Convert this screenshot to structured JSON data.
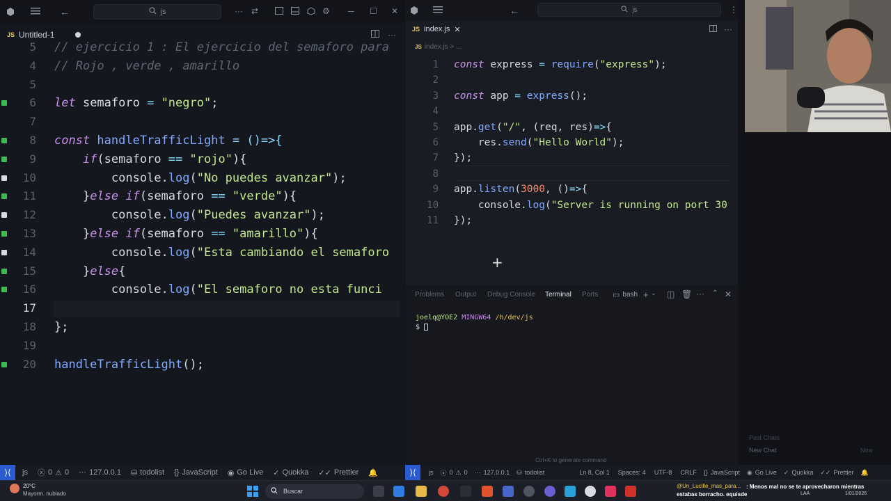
{
  "left_window": {
    "search_text": "js",
    "tab": {
      "badge": "JS",
      "label": "Untitled-1"
    },
    "lines": [
      {
        "num": "5",
        "tokens": [
          [
            "c",
            "// ejercicio 1 : El ejercicio del semaforo para"
          ]
        ]
      },
      {
        "num": "4",
        "tokens": [
          [
            "c",
            "// Rojo , verde , amarillo"
          ]
        ]
      },
      {
        "num": "5",
        "tokens": []
      },
      {
        "num": "6",
        "tokens": [
          [
            "k",
            "let"
          ],
          [
            "v",
            " semaforo "
          ],
          [
            "p",
            "="
          ],
          [
            "s",
            " \"negro\""
          ],
          [
            "v",
            ";"
          ]
        ]
      },
      {
        "num": "7",
        "tokens": []
      },
      {
        "num": "8",
        "tokens": [
          [
            "k",
            "const"
          ],
          [
            "f",
            " handleTrafficLight"
          ],
          [
            "p",
            " = ()=>{"
          ]
        ]
      },
      {
        "num": "9",
        "tokens": [
          [
            "v",
            "    "
          ],
          [
            "k",
            "if"
          ],
          [
            "v",
            "(semaforo "
          ],
          [
            "p",
            "=="
          ],
          [
            "s",
            " \"rojo\""
          ],
          [
            "v",
            "){"
          ]
        ]
      },
      {
        "num": "10",
        "tokens": [
          [
            "v",
            "        console."
          ],
          [
            "f",
            "log"
          ],
          [
            "v",
            "("
          ],
          [
            "s",
            "\"No puedes avanzar\""
          ],
          [
            "v",
            ");"
          ]
        ]
      },
      {
        "num": "11",
        "tokens": [
          [
            "v",
            "    }"
          ],
          [
            "k",
            "else if"
          ],
          [
            "v",
            "(semaforo "
          ],
          [
            "p",
            "=="
          ],
          [
            "s",
            " \"verde\""
          ],
          [
            "v",
            "){"
          ]
        ]
      },
      {
        "num": "12",
        "tokens": [
          [
            "v",
            "        console."
          ],
          [
            "f",
            "log"
          ],
          [
            "v",
            "("
          ],
          [
            "s",
            "\"Puedes avanzar\""
          ],
          [
            "v",
            ");"
          ]
        ]
      },
      {
        "num": "13",
        "tokens": [
          [
            "v",
            "    }"
          ],
          [
            "k",
            "else if"
          ],
          [
            "v",
            "(semaforo "
          ],
          [
            "p",
            "=="
          ],
          [
            "s",
            " \"amarillo\""
          ],
          [
            "v",
            "){"
          ]
        ]
      },
      {
        "num": "14",
        "tokens": [
          [
            "v",
            "        console."
          ],
          [
            "f",
            "log"
          ],
          [
            "v",
            "("
          ],
          [
            "s",
            "\"Esta cambiando el semaforo"
          ]
        ]
      },
      {
        "num": "15",
        "tokens": [
          [
            "v",
            "    }"
          ],
          [
            "k",
            "else"
          ],
          [
            "v",
            "{"
          ]
        ]
      },
      {
        "num": "16",
        "tokens": [
          [
            "v",
            "        console."
          ],
          [
            "f",
            "log"
          ],
          [
            "v",
            "("
          ],
          [
            "s",
            "\"El semaforo no esta funci"
          ]
        ]
      },
      {
        "num": "17",
        "tokens": [
          [
            "v",
            "    }"
          ]
        ]
      },
      {
        "num": "18",
        "tokens": [
          [
            "v",
            "};"
          ]
        ]
      },
      {
        "num": "19",
        "tokens": []
      },
      {
        "num": "20",
        "tokens": [
          [
            "f",
            "handleTrafficLight"
          ],
          [
            "v",
            "();"
          ]
        ]
      }
    ],
    "status": {
      "lang_short": "js",
      "errors": "0",
      "warnings": "0",
      "host": "127.0.0.1",
      "branch": "todolist",
      "language": "JavaScript",
      "go_live": "Go Live",
      "quokka": "Quokka",
      "prettier": "Prettier"
    }
  },
  "right_window": {
    "search_text": "js",
    "tab": {
      "badge": "JS",
      "label": "index.js"
    },
    "breadcrumb": "index.js > ...",
    "lines": [
      {
        "num": "1",
        "tokens": [
          [
            "k",
            "const"
          ],
          [
            "v",
            " express "
          ],
          [
            "p",
            "="
          ],
          [
            "f",
            " require"
          ],
          [
            "v",
            "("
          ],
          [
            "s",
            "\"express\""
          ],
          [
            "v",
            ");"
          ]
        ]
      },
      {
        "num": "2",
        "tokens": []
      },
      {
        "num": "3",
        "tokens": [
          [
            "k",
            "const"
          ],
          [
            "v",
            " app "
          ],
          [
            "p",
            "="
          ],
          [
            "f",
            " express"
          ],
          [
            "v",
            "();"
          ]
        ]
      },
      {
        "num": "4",
        "tokens": []
      },
      {
        "num": "5",
        "tokens": [
          [
            "v",
            "app."
          ],
          [
            "f",
            "get"
          ],
          [
            "v",
            "("
          ],
          [
            "s",
            "\"/\""
          ],
          [
            "v",
            ", (req, res)"
          ],
          [
            "p",
            "=>"
          ],
          [
            "v",
            "{"
          ]
        ]
      },
      {
        "num": "6",
        "tokens": [
          [
            "v",
            "    res."
          ],
          [
            "f",
            "send"
          ],
          [
            "v",
            "("
          ],
          [
            "s",
            "\"Hello World\""
          ],
          [
            "v",
            ");"
          ]
        ]
      },
      {
        "num": "7",
        "tokens": [
          [
            "v",
            "});"
          ]
        ]
      },
      {
        "num": "8",
        "tokens": []
      },
      {
        "num": "9",
        "tokens": [
          [
            "v",
            "app."
          ],
          [
            "f",
            "listen"
          ],
          [
            "v",
            "("
          ],
          [
            "n",
            "3000"
          ],
          [
            "v",
            ", ()"
          ],
          [
            "p",
            "=>"
          ],
          [
            "v",
            "{"
          ]
        ]
      },
      {
        "num": "10",
        "tokens": [
          [
            "v",
            "    console."
          ],
          [
            "f",
            "log"
          ],
          [
            "v",
            "("
          ],
          [
            "s",
            "\"Server is running on port 30"
          ]
        ]
      },
      {
        "num": "11",
        "tokens": [
          [
            "v",
            "});"
          ]
        ]
      }
    ],
    "panel": {
      "tabs": [
        "Problems",
        "Output",
        "Debug Console",
        "Terminal",
        "Ports"
      ],
      "active_tab": "Terminal",
      "shell": "bash",
      "prompt_user": "joelq@YOE2",
      "prompt_env": "MINGW64",
      "prompt_path": "/h/dev/js",
      "prompt_symbol": "$"
    },
    "hint": "Ctrl+K to generate command",
    "status": {
      "lang_short": "js",
      "errors": "0",
      "warnings": "0",
      "host": "127.0.0.1",
      "branch": "todolist",
      "cursor": "Ln 8, Col 1",
      "spaces": "Spaces: 4",
      "encoding": "UTF-8",
      "eol": "CRLF",
      "language": "JavaScript",
      "go_live": "Go Live",
      "quokka": "Quokka",
      "prettier": "Prettier"
    }
  },
  "chat": {
    "past_chats": "Past Chats",
    "new_chat": "New Chat",
    "now": "Now"
  },
  "taskbar": {
    "weather_temp": "20°C",
    "weather_desc": "Mayorm. nublado",
    "search_placeholder": "Buscar",
    "chat_user": "@Un_Lucille_mas_para...",
    "chat_message": ": Menos mal no se te aprovecharon mientras estabas borracho. equisde",
    "lang": "LAA",
    "date": "1/01/2026"
  }
}
